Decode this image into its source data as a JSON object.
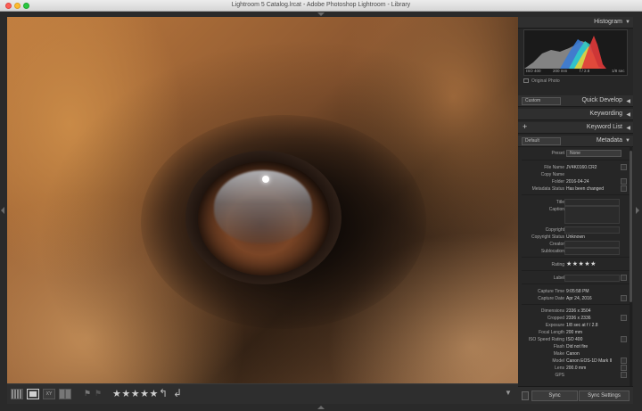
{
  "window": {
    "title": "Lightroom 5 Catalog.lrcat - Adobe Photoshop Lightroom - Library"
  },
  "toolbar": {
    "compare_label": "XY",
    "stars": "★★★★★",
    "flag_pick": "⚑",
    "flag_reject": "⚑",
    "rotate_left": "↰",
    "rotate_right": "↲",
    "dropdown_arrow": "▼"
  },
  "panels": {
    "histogram": {
      "title": "Histogram",
      "iso": "ISO 400",
      "focal": "200 mm",
      "aperture": "f / 2.8",
      "shutter": "1/8 sec",
      "original_photo": "Original Photo"
    },
    "quick_develop": {
      "title": "Quick Develop",
      "preset": "Custom"
    },
    "keywording": {
      "title": "Keywording"
    },
    "keyword_list": {
      "title": "Keyword List",
      "plus": "+"
    },
    "metadata": {
      "title": "Metadata",
      "preset_set": "Default"
    }
  },
  "metadata": {
    "preset_label": "Preset",
    "preset_value": "None",
    "rows": [
      {
        "label": "File Name",
        "value": "JV4K0160.CR2"
      },
      {
        "label": "Copy Name",
        "value": ""
      },
      {
        "label": "Folder",
        "value": "2016-04-24"
      },
      {
        "label": "Metadata Status",
        "value": "Has been changed"
      },
      {
        "label": "Title",
        "value": ""
      },
      {
        "label": "Caption",
        "value": ""
      },
      {
        "label": "Copyright",
        "value": ""
      },
      {
        "label": "Copyright Status",
        "value": "Unknown"
      },
      {
        "label": "Creator",
        "value": ""
      },
      {
        "label": "Sublocation",
        "value": ""
      },
      {
        "label": "Rating",
        "value": "★★★★★"
      },
      {
        "label": "Label",
        "value": ""
      },
      {
        "label": "Capture Time",
        "value": "9:05:58 PM"
      },
      {
        "label": "Capture Date",
        "value": "Apr 24, 2016"
      },
      {
        "label": "Dimensions",
        "value": "2336 x 3504"
      },
      {
        "label": "Cropped",
        "value": "2336 x 2336"
      },
      {
        "label": "Exposure",
        "value": "1/8 sec at f / 2.8"
      },
      {
        "label": "Focal Length",
        "value": "200 mm"
      },
      {
        "label": "ISO Speed Rating",
        "value": "ISO 400"
      },
      {
        "label": "Flash",
        "value": "Did not fire"
      },
      {
        "label": "Make",
        "value": "Canon"
      },
      {
        "label": "Model",
        "value": "Canon EOS-1D Mark II"
      },
      {
        "label": "Lens",
        "value": "200.0 mm"
      },
      {
        "label": "GPS",
        "value": ""
      }
    ]
  },
  "sync": {
    "metadata_label": "Sync",
    "settings_label": "Sync Settings"
  }
}
